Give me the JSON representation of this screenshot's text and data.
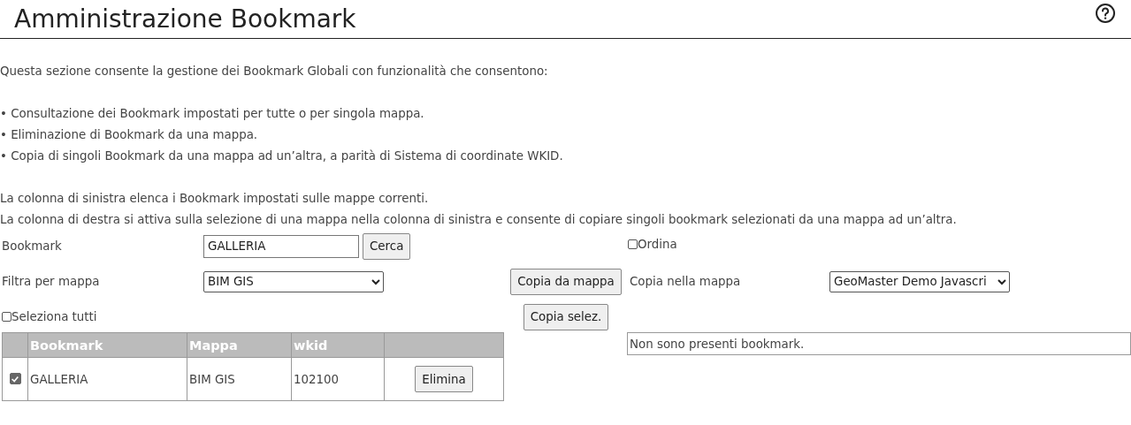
{
  "header": {
    "title": "Amministrazione Bookmark",
    "help_icon": true
  },
  "intro": "Questa sezione consente la gestione dei Bookmark Globali con funzionalità che consentono:",
  "bullets": [
    "• Consultazione dei Bookmark impostati per tutte o per singola mappa.",
    "• Eliminazione di Bookmark da una mappa.",
    "• Copia di singoli Bookmark da una mappa ad un’altra, a parità di Sistema di coordinate WKID."
  ],
  "notes": [
    "La colonna di sinistra elenca i Bookmark impostati sulle mappe correnti.",
    "La colonna di destra si attiva sulla selezione di una mappa nella colonna di sinistra e consente di copiare singoli bookmark selezionati da una mappa ad un’altra."
  ],
  "search": {
    "label": "Bookmark",
    "value": "GALLERIA",
    "button": "Cerca"
  },
  "sort": {
    "label": "Ordina",
    "checked": false
  },
  "filter": {
    "label": "Filtra per mappa",
    "value": "BIM GIS"
  },
  "copy_from_button": "Copia da mappa",
  "target": {
    "label": "Copia nella mappa",
    "value": "GeoMaster Demo Javascri"
  },
  "select_all": {
    "label": "Seleziona tutti",
    "checked": false
  },
  "copy_selected_button": "Copia selez.",
  "table": {
    "columns": [
      "Bookmark",
      "Mappa",
      "wkid"
    ],
    "rows": [
      {
        "checked": true,
        "cells": [
          "GALLERIA",
          "BIM GIS",
          "102100"
        ],
        "button": "Elimina"
      }
    ]
  },
  "right_list": {
    "message": "Non sono presenti bookmark."
  }
}
